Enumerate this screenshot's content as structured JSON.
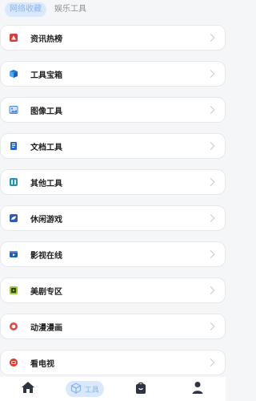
{
  "tabs": [
    {
      "label": "网络收藏",
      "active": true
    },
    {
      "label": "娱乐工具",
      "active": false
    }
  ],
  "items": [
    {
      "label": "资讯热榜",
      "icon": "hot-list-icon",
      "color": "#d93b3b"
    },
    {
      "label": "工具宝箱",
      "icon": "toolbox-icon",
      "color": "#1f7fd8"
    },
    {
      "label": "图像工具",
      "icon": "image-icon",
      "color": "#4b86d8"
    },
    {
      "label": "文档工具",
      "icon": "document-icon",
      "color": "#2e66c7"
    },
    {
      "label": "其他工具",
      "icon": "other-tools-icon",
      "color": "#2b8fb0"
    },
    {
      "label": "休闲游戏",
      "icon": "game-icon",
      "color": "#2f5db5"
    },
    {
      "label": "影视在线",
      "icon": "video-icon",
      "color": "#1d5fb2"
    },
    {
      "label": "美剧专区",
      "icon": "tv-series-icon",
      "color": "#9cc832"
    },
    {
      "label": "动漫漫画",
      "icon": "anime-icon",
      "color": "#e14a4a"
    },
    {
      "label": "看电视",
      "icon": "tv-icon",
      "color": "#d93a2c"
    }
  ],
  "bottom_nav": {
    "tools_label": "工具",
    "items": [
      "home-icon",
      "tools-cube-icon",
      "bag-icon",
      "profile-icon"
    ]
  }
}
